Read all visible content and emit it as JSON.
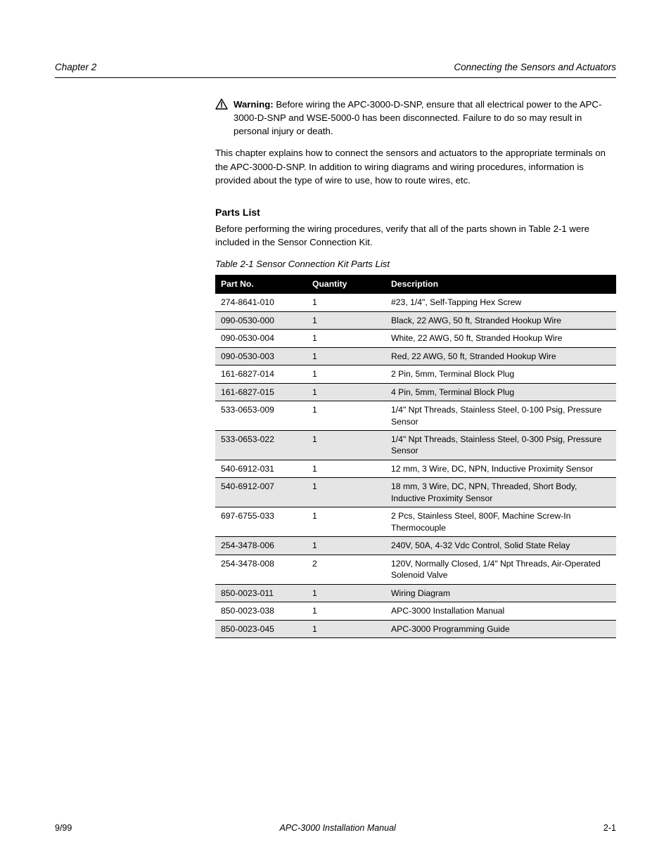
{
  "header": {
    "left": "Chapter 2",
    "right": "Connecting the Sensors and Actuators"
  },
  "warning": {
    "label": "Warning:",
    "text": "Before wiring the APC-3000-D-SNP, ensure that all electrical power to the APC-3000-D-SNP and WSE-5000-0 has been disconnected. Failure to do so may result in personal injury or death."
  },
  "overview_paragraph": "This chapter explains how to connect the sensors and actuators to the appropriate terminals on the APC-3000-D-SNP. In addition to wiring diagrams and wiring procedures, information is provided about the type of wire to use, how to route wires, etc.",
  "parts_section": {
    "title": "Parts List",
    "intro": "Before performing the wiring procedures, verify that all of the parts shown in Table 2-1 were included in the Sensor Connection Kit.",
    "caption": "Table 2-1    Sensor Connection Kit Parts List",
    "columns": [
      "Part No.",
      "Quantity",
      "Description"
    ],
    "rows": [
      {
        "part": "274-8641-010",
        "qty": "1",
        "desc": "#23, 1/4\", Self-Tapping Hex Screw"
      },
      {
        "part": "090-0530-000",
        "qty": "1",
        "desc": "Black, 22 AWG, 50 ft, Stranded Hookup Wire"
      },
      {
        "part": "090-0530-004",
        "qty": "1",
        "desc": "White, 22 AWG, 50 ft, Stranded Hookup Wire"
      },
      {
        "part": "090-0530-003",
        "qty": "1",
        "desc": "Red, 22 AWG, 50 ft, Stranded Hookup Wire"
      },
      {
        "part": "161-6827-014",
        "qty": "1",
        "desc": "2 Pin, 5mm, Terminal Block Plug"
      },
      {
        "part": "161-6827-015",
        "qty": "1",
        "desc": "4 Pin, 5mm, Terminal Block Plug"
      },
      {
        "part": "533-0653-009",
        "qty": "1",
        "desc": "1/4\" Npt Threads, Stainless Steel, 0-100 Psig, Pressure Sensor"
      },
      {
        "part": "533-0653-022",
        "qty": "1",
        "desc": "1/4\" Npt Threads, Stainless Steel, 0-300 Psig, Pressure Sensor"
      },
      {
        "part": "540-6912-031",
        "qty": "1",
        "desc": "12 mm, 3 Wire, DC, NPN, Inductive Proximity Sensor"
      },
      {
        "part": "540-6912-007",
        "qty": "1",
        "desc": "18 mm, 3 Wire, DC, NPN, Threaded, Short Body, Inductive Proximity Sensor"
      },
      {
        "part": "697-6755-033",
        "qty": "1",
        "desc": "2 Pcs, Stainless Steel, 800F, Machine Screw-In Thermocouple"
      },
      {
        "part": "254-3478-006",
        "qty": "1",
        "desc": "240V, 50A, 4-32 Vdc Control, Solid State Relay"
      },
      {
        "part": "254-3478-008",
        "qty": "2",
        "desc": "120V, Normally Closed, 1/4\" Npt Threads, Air-Operated Solenoid Valve"
      },
      {
        "part": "850-0023-011",
        "qty": "1",
        "desc": "Wiring Diagram"
      },
      {
        "part": "850-0023-038",
        "qty": "1",
        "desc": "APC-3000 Installation Manual"
      },
      {
        "part": "850-0023-045",
        "qty": "1",
        "desc": "APC-3000 Programming Guide"
      }
    ]
  },
  "footer": {
    "left": "9/99",
    "mid": "APC-3000 Installation Manual",
    "right": "2-1"
  }
}
